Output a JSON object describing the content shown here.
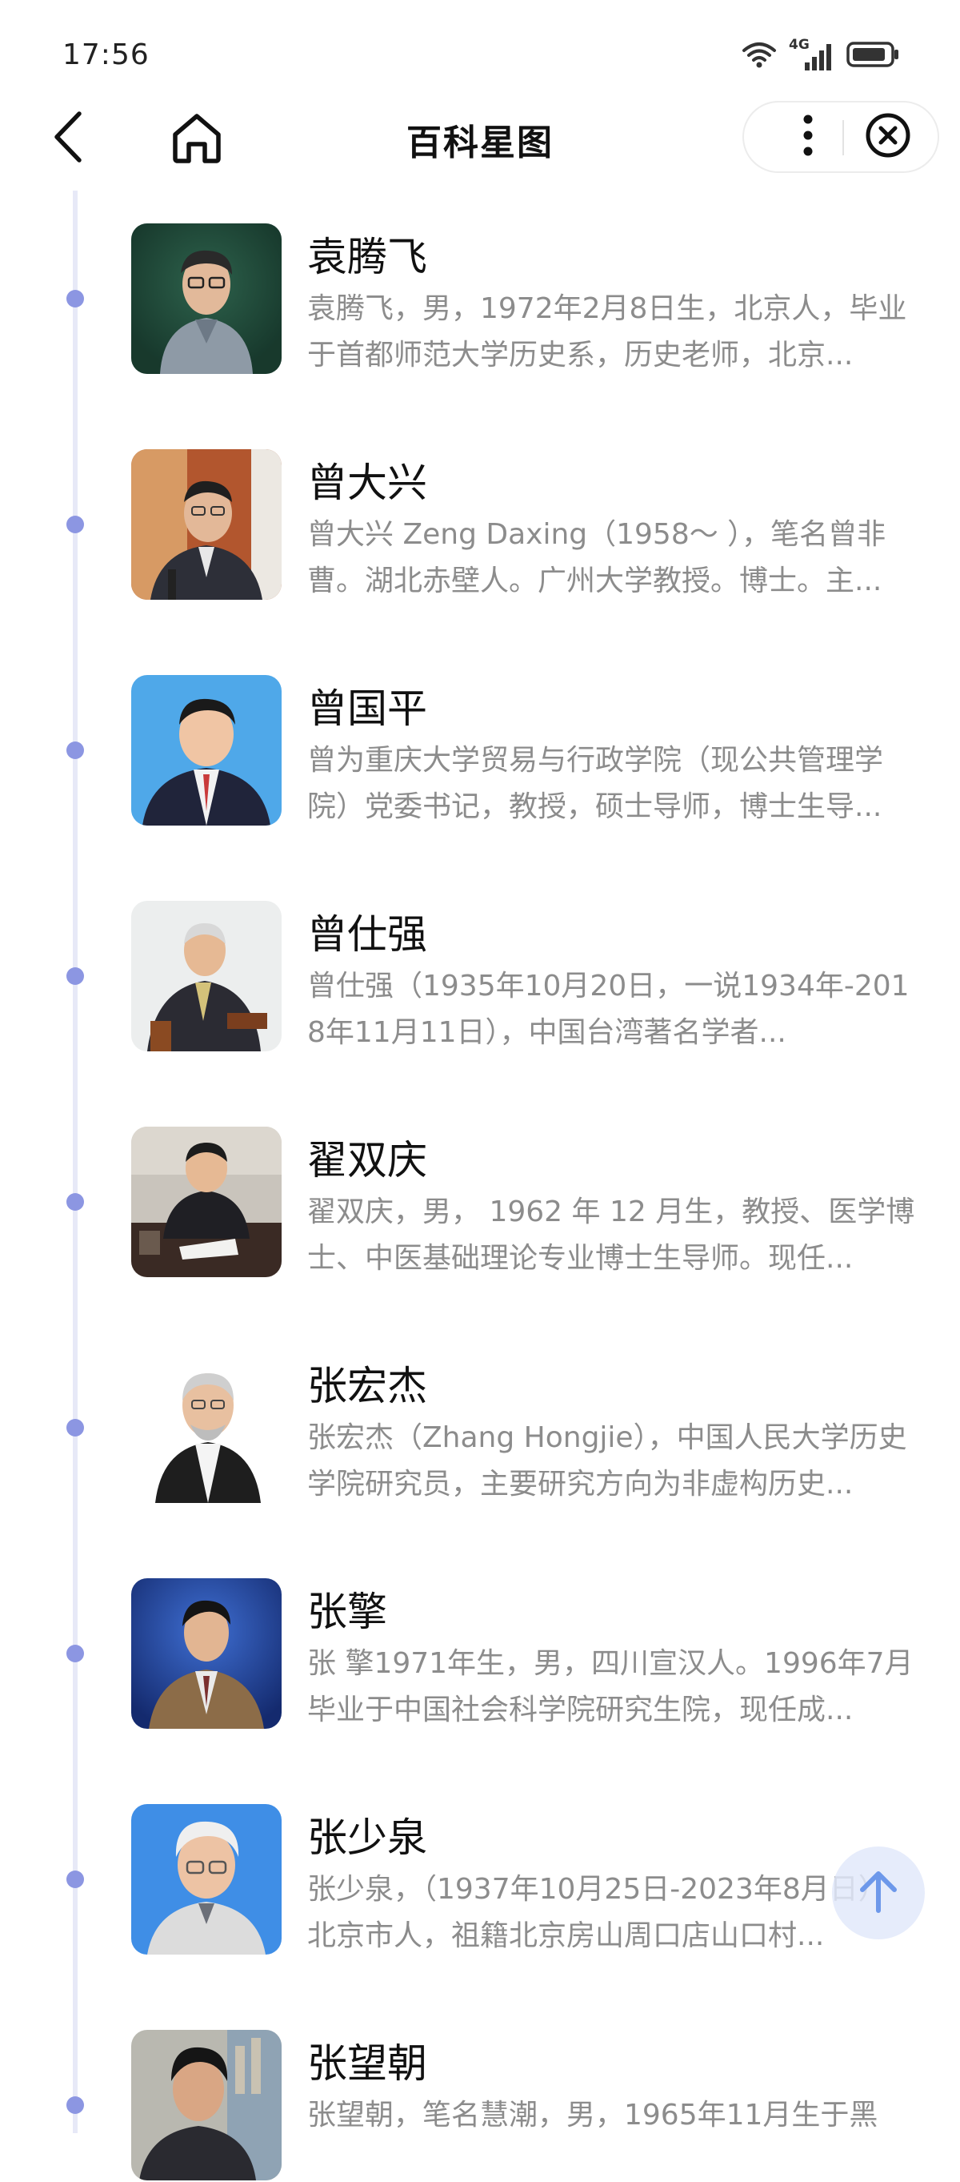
{
  "status_bar": {
    "time": "17:56",
    "network_label": "4G",
    "icons": [
      "wifi-icon",
      "cellular-signal-icon",
      "battery-icon"
    ]
  },
  "nav": {
    "title": "百科星图",
    "icons": [
      "back-chevron-icon",
      "home-icon",
      "more-vertical-icon",
      "close-circle-icon"
    ]
  },
  "colors": {
    "timeline_dot": "#8c96e2",
    "timeline_line": "#e7e9f7",
    "description_text": "#8c8c8c",
    "scroll_top_arrow": "#6d98ea"
  },
  "people": [
    {
      "name": "袁腾飞",
      "description": "袁腾飞，男，1972年2月8日生，北京人，毕业于首都师范大学历史系，历史老师，北京..."
    },
    {
      "name": "曾大兴",
      "description": "曾大兴 Zeng Daxing（1958～ ），笔名曾非曹。湖北赤壁人。广州大学教授。博士。主..."
    },
    {
      "name": "曾国平",
      "description": "曾为重庆大学贸易与行政学院（现公共管理学院）党委书记，教授，硕士导师，博士生导..."
    },
    {
      "name": "曾仕强",
      "description": "曾仕强（1935年10月20日，一说1934年-2018年11月11日），中国台湾著名学者..."
    },
    {
      "name": "翟双庆",
      "description": "翟双庆，男， 1962 年 12 月生，教授、医学博士、中医基础理论专业博士生导师。现任..."
    },
    {
      "name": "张宏杰",
      "description": "张宏杰（Zhang Hongjie），中国人民大学历史学院研究员，主要研究方向为非虚构历史..."
    },
    {
      "name": "张擎",
      "description": "张 擎1971年生，男，四川宣汉人。1996年7月毕业于中国社会科学院研究生院，现任成..."
    },
    {
      "name": "张少泉",
      "description": "张少泉，（1937年10月25日-2023年8月日）北京市人，祖籍北京房山周口店山口村..."
    },
    {
      "name": "张望朝",
      "description": "张望朝，笔名慧潮，男，1965年11月生于黑"
    }
  ],
  "scroll_top": {
    "icon": "arrow-up-icon"
  }
}
